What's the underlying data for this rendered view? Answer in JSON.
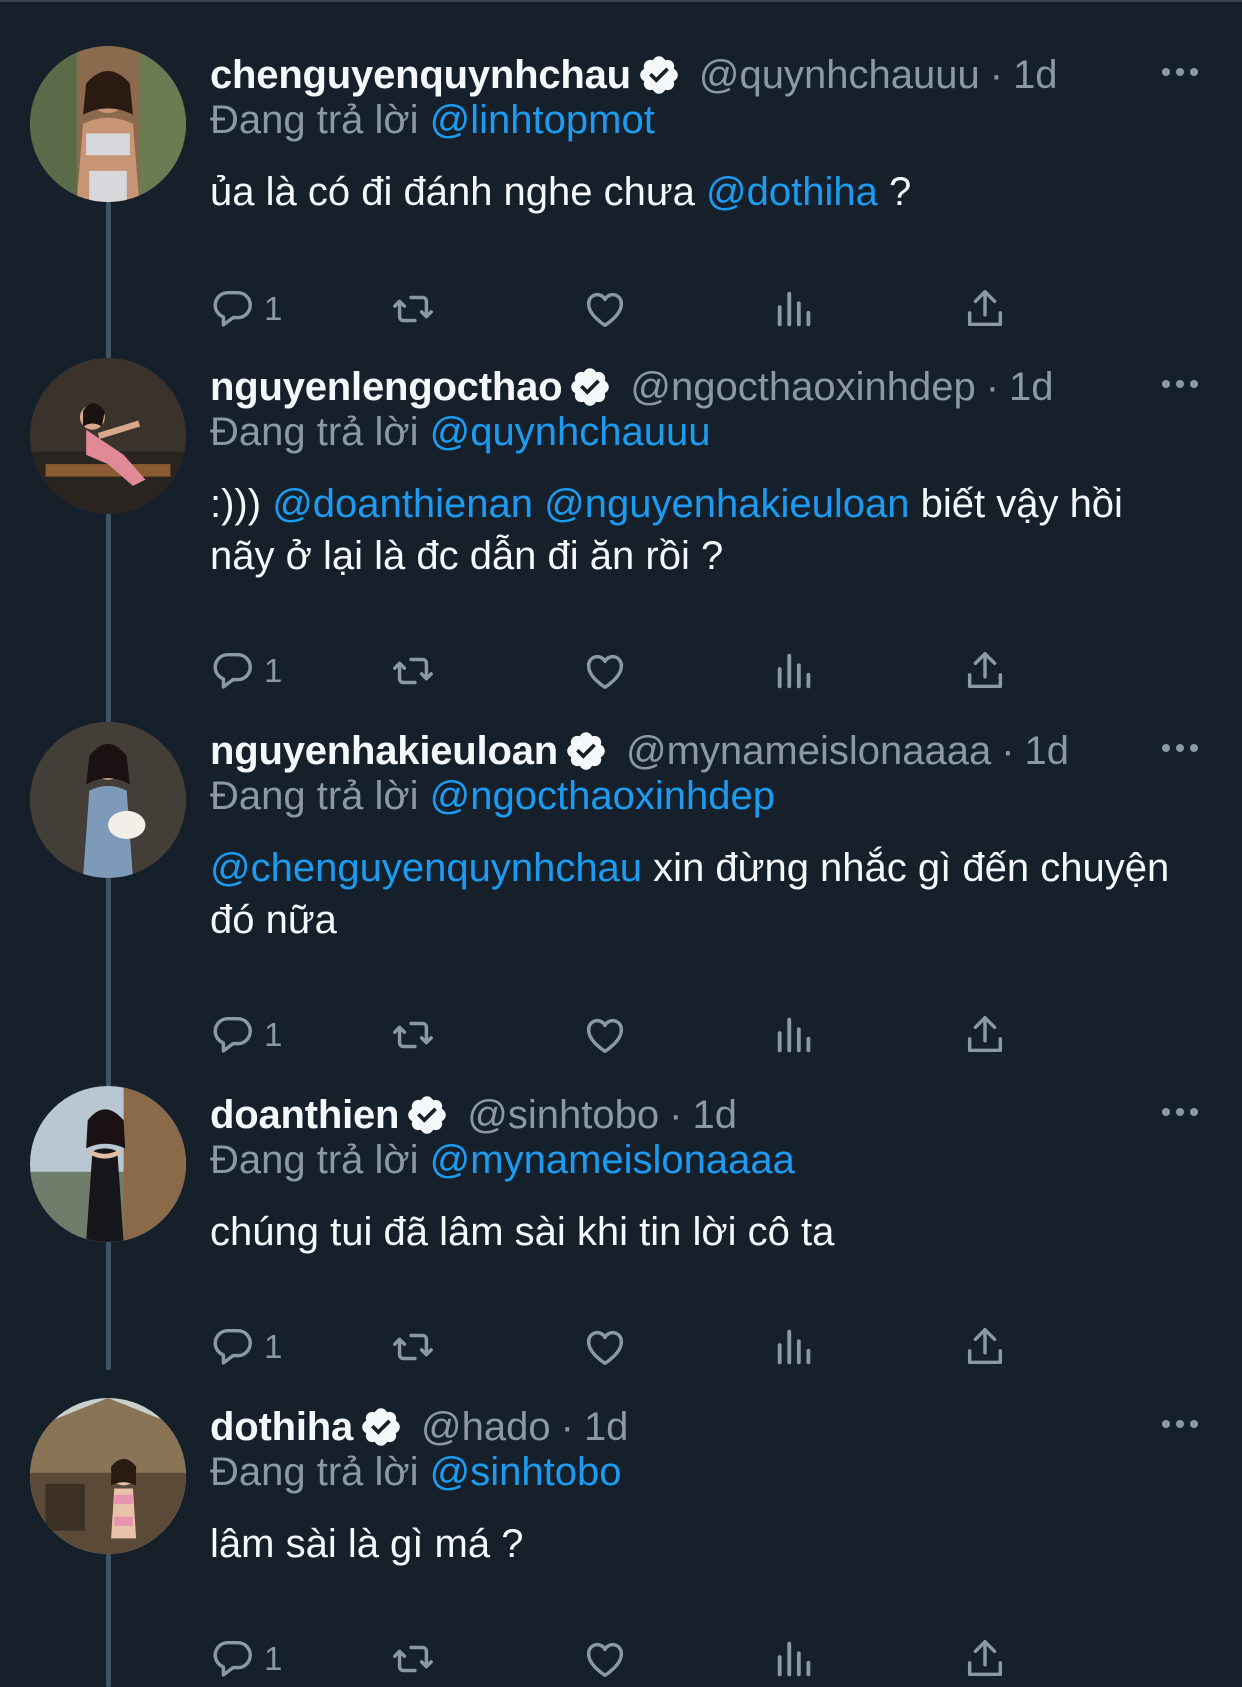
{
  "reply_prefix": "Đang trả lời",
  "colors": {
    "background": "#15202b",
    "text": "#f5f8fa",
    "muted": "#8b98a5",
    "link": "#1d9bf0",
    "thread_line": "#3d5466"
  },
  "icons": {
    "verified": "verified-badge-icon",
    "more": "more-horizontal-icon",
    "reply": "reply-bubble-icon",
    "retweet": "retweet-icon",
    "like": "heart-icon",
    "views": "bar-chart-icon",
    "share": "share-upload-icon"
  },
  "tweets": [
    {
      "display_name": "chenguyenquynhchau",
      "handle": "@quynhchauuu",
      "time": "1d",
      "reply_to": "@linhtopmot",
      "text_parts": [
        "ủa là có đi đánh nghe chưa ",
        "@dothiha",
        " ?"
      ],
      "reply_count": "1"
    },
    {
      "display_name": "nguyenlengocthao",
      "handle": "@ngocthaoxinhdep",
      "time": "1d",
      "reply_to": "@quynhchauuu",
      "text_parts": [
        ":))) ",
        "@doanthienan",
        " ",
        "@nguyenhakieuloan",
        " biết vậy hồi nãy ở lại là đc dẫn đi ăn rồi ?"
      ],
      "reply_count": "1"
    },
    {
      "display_name": "nguyenhakieuloan",
      "handle": "@mynameislonaaaa",
      "time": "1d",
      "reply_to": "@ngocthaoxinhdep",
      "text_parts": [
        "@chenguyenquynhchau",
        " xin đừng nhắc gì đến chuyện đó nữa"
      ],
      "reply_count": "1"
    },
    {
      "display_name": "doanthien",
      "handle": "@sinhtobo",
      "time": "1d",
      "reply_to": "@mynameislonaaaa",
      "text_parts": [
        "chúng tui đã lâm sài khi tin lời cô ta"
      ],
      "reply_count": "1"
    },
    {
      "display_name": "dothiha",
      "handle": "@hado",
      "time": "1d",
      "reply_to": "@sinhtobo",
      "text_parts": [
        "lâm sài là gì má ?"
      ],
      "reply_count": "1"
    }
  ]
}
